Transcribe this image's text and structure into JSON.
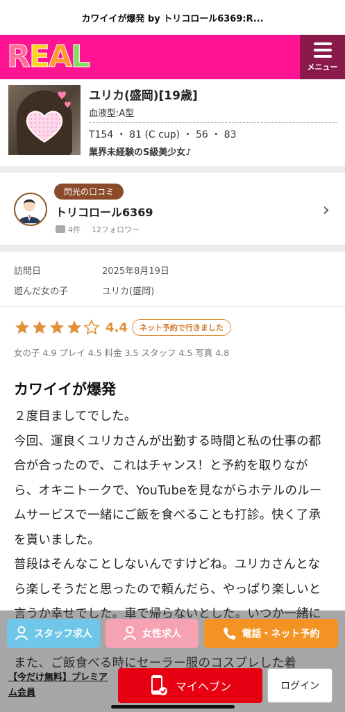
{
  "window": {
    "title": "カワイイが爆発 by トリコロール6369:R..."
  },
  "header": {
    "logo": "REAL",
    "logo_colors": [
      "#ff6b9a",
      "#ffd21f",
      "#ff9b2e",
      "#7fe05a"
    ],
    "menu_label": "メニュー",
    "brand_color": "#ff1493"
  },
  "profile": {
    "name": "ユリカ(盛岡)[19歳]",
    "blood": "血液型:A型",
    "size": "T154 ・ 81 (C cup) ・ 56 ・ 83",
    "catchphrase": "業界未経験のS級美少女♪"
  },
  "reviewer": {
    "badge": "閃光の口コミ",
    "name": "トリコロール6369",
    "post_count": "4件",
    "followers": "12フォロワー"
  },
  "visit": {
    "date_label": "訪問日",
    "date_value": "2025年8月19日",
    "girl_label": "遊んだ女の子",
    "girl_value": "ユリカ(盛岡)"
  },
  "rating": {
    "stars": 4,
    "stars_max": 5,
    "score": "4.4",
    "reservation_badge": "ネット予約で行きました",
    "sub": "女の子 4.9 プレイ 4.5 料金 3.5 スタッフ 4.5 写真 4.8"
  },
  "review": {
    "title": "カワイイが爆発",
    "paragraphs": [
      "２度目ましてでした。",
      "今回、運良くユリカさんが出勤する時間と私の仕事の都合が合ったので、これはチャンス！と予約を取りながら、オキニトークで、YouTubeを見ながらホテルのルームサービスで一緒にご飯を食べることも打診。快く了承を貰いました。",
      "普段はそんなことしないんですけどね。ユリカさんとなら楽しそうだと思ったので頼んだら、やっぱり楽しいと言うか幸せでした。車で帰らないとした。いつか一緒に飲みたいなー",
      "また、ご飯食べる時にセーラー服のコスプレした着"
    ]
  },
  "floating": {
    "staff_label": "スタッフ求人",
    "female_label": "女性求人",
    "tel_label": "電話・ネット予約",
    "premium_label": "【今だけ無料】プレミアム会員",
    "myheaven_label": "マイヘブン",
    "login_label": "ログイン"
  }
}
